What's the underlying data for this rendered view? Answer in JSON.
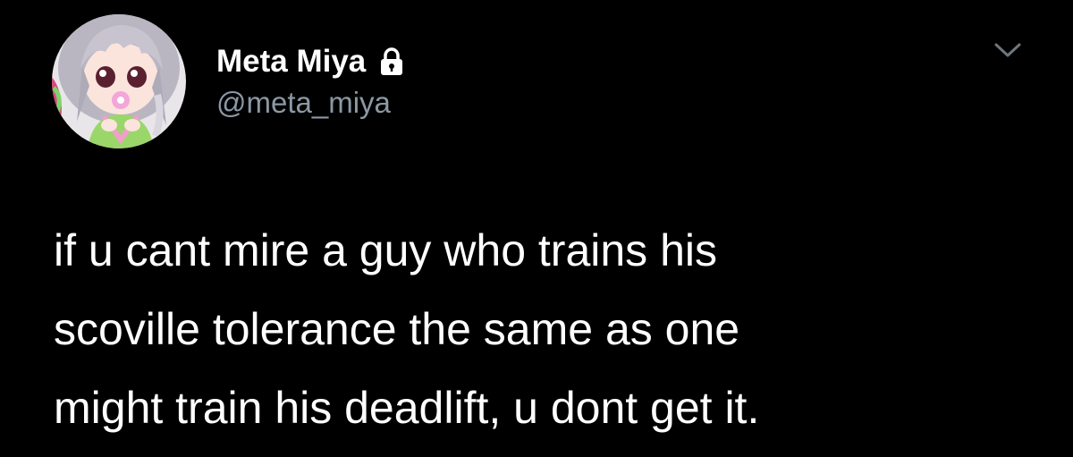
{
  "author": {
    "display_name": "Meta Miya",
    "handle": "@meta_miya",
    "avatar_icon": "avatar-anime-character",
    "protected_icon": "lock-icon"
  },
  "menu": {
    "icon": "chevron-down-icon"
  },
  "tweet": {
    "lines": [
      "if u cant mire a guy who trains his",
      "scoville tolerance the same as one",
      "might train his deadlift, u dont get it."
    ]
  },
  "colors": {
    "background": "#000000",
    "text": "#ffffff",
    "secondary_text": "#8b98a5"
  }
}
